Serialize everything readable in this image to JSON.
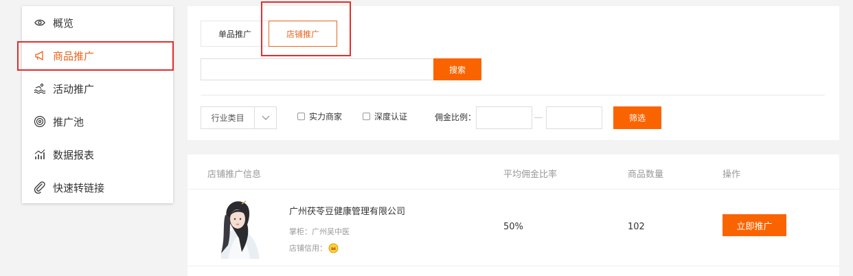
{
  "sidebar": {
    "items": [
      {
        "label": "概览",
        "icon": "eye-icon"
      },
      {
        "label": "商品推广",
        "icon": "megaphone-icon",
        "active": true
      },
      {
        "label": "活动推广",
        "icon": "swim-icon"
      },
      {
        "label": "推广池",
        "icon": "target-icon"
      },
      {
        "label": "数据报表",
        "icon": "bar-chart-icon"
      },
      {
        "label": "快速转链接",
        "icon": "paperclip-icon"
      }
    ]
  },
  "tabs": [
    {
      "label": "单品推广"
    },
    {
      "label": "店铺推广",
      "active": true
    }
  ],
  "search": {
    "value": "",
    "button_label": "搜索"
  },
  "filters": {
    "category_label": "行业类目",
    "checkbox_strong": "实力商家",
    "checkbox_certified": "深度认证",
    "ratio_label": "佣金比例：",
    "ratio_min": "",
    "ratio_max": "",
    "filter_button": "筛选"
  },
  "table": {
    "headers": [
      "店铺推广信息",
      "平均佣金比率",
      "商品数量",
      "操作"
    ],
    "rows": [
      {
        "shop_name": "广州茯苓豆健康管理有限公司",
        "keeper": "掌柜：广州吴中医",
        "credit_label": "店铺信用：",
        "avg_ratio": "50%",
        "count": "102",
        "action": "立即推广"
      }
    ]
  },
  "colors": {
    "accent": "#fa6400",
    "active_text": "#e8641e",
    "highlight": "#e52b2b"
  }
}
